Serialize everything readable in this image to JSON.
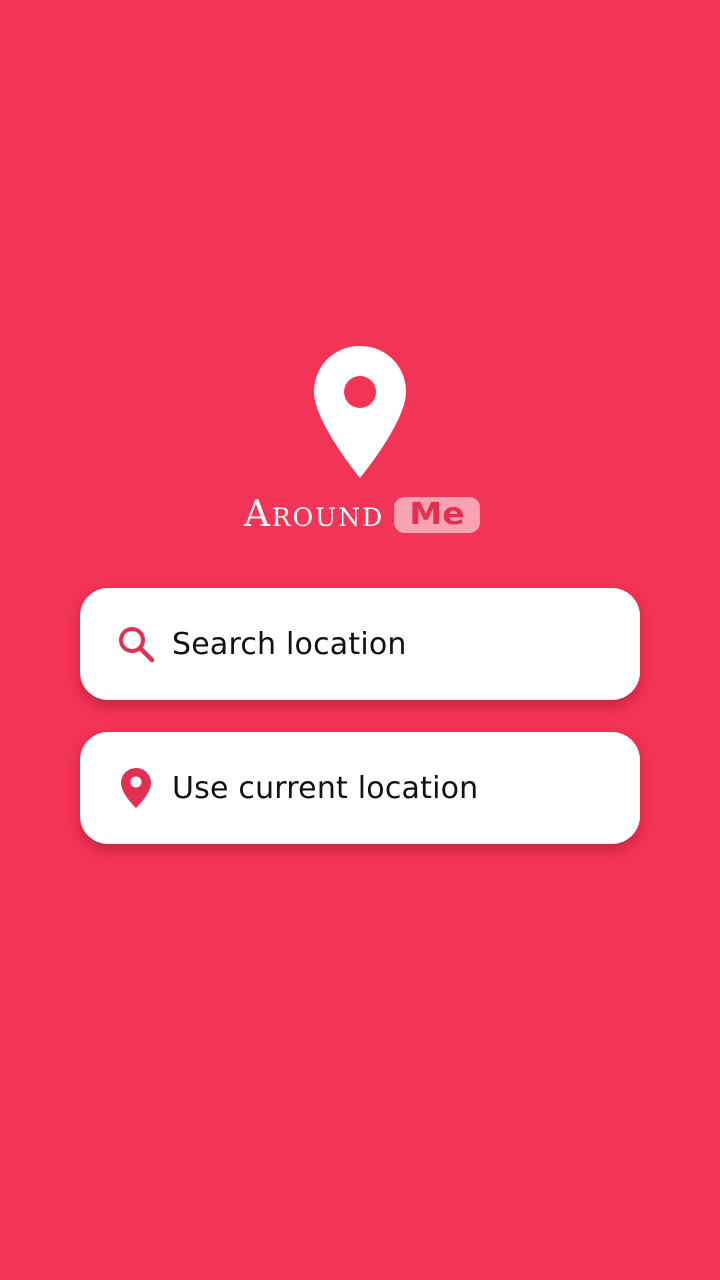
{
  "colors": {
    "background": "#f23456",
    "accent": "#e33052",
    "card": "#ffffff",
    "text": "#111111"
  },
  "brand": {
    "logo_icon": "map-pin-icon",
    "title_part1": "Around",
    "title_part2": "Me"
  },
  "actions": {
    "search": {
      "icon": "search-icon",
      "label": "Search location"
    },
    "current": {
      "icon": "location-pin-icon",
      "label": "Use current location"
    }
  }
}
